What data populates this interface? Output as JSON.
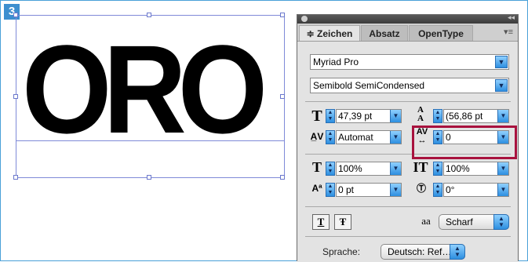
{
  "figure": {
    "step_number": "3"
  },
  "canvas": {
    "sample_text": "ORO"
  },
  "panel": {
    "tabs": [
      {
        "label": "≑ Zeichen",
        "active": true
      },
      {
        "label": "Absatz",
        "active": false
      },
      {
        "label": "OpenType",
        "active": false
      }
    ],
    "collapse_glyph": "◂◂",
    "font_family": "Myriad Pro",
    "font_style": "Semibold SemiCondensed",
    "font_size": "47,39 pt",
    "leading": "(56,86 pt",
    "kerning": "Automat",
    "tracking": "0",
    "vertical_scale": "100%",
    "horizontal_scale": "100%",
    "baseline_shift": "0 pt",
    "character_rotation": "0°",
    "antialias_glyph": "aa",
    "antialias": "Scharf",
    "language_label": "Sprache:",
    "language": "Deutsch: Ref…",
    "underline_glyph": "T",
    "strikethrough_glyph": "Ŧ"
  },
  "colors": {
    "accent": "#3d8fcf",
    "highlight_border": "#a8123e",
    "dropdown_arrow": "#2d8fe0"
  }
}
